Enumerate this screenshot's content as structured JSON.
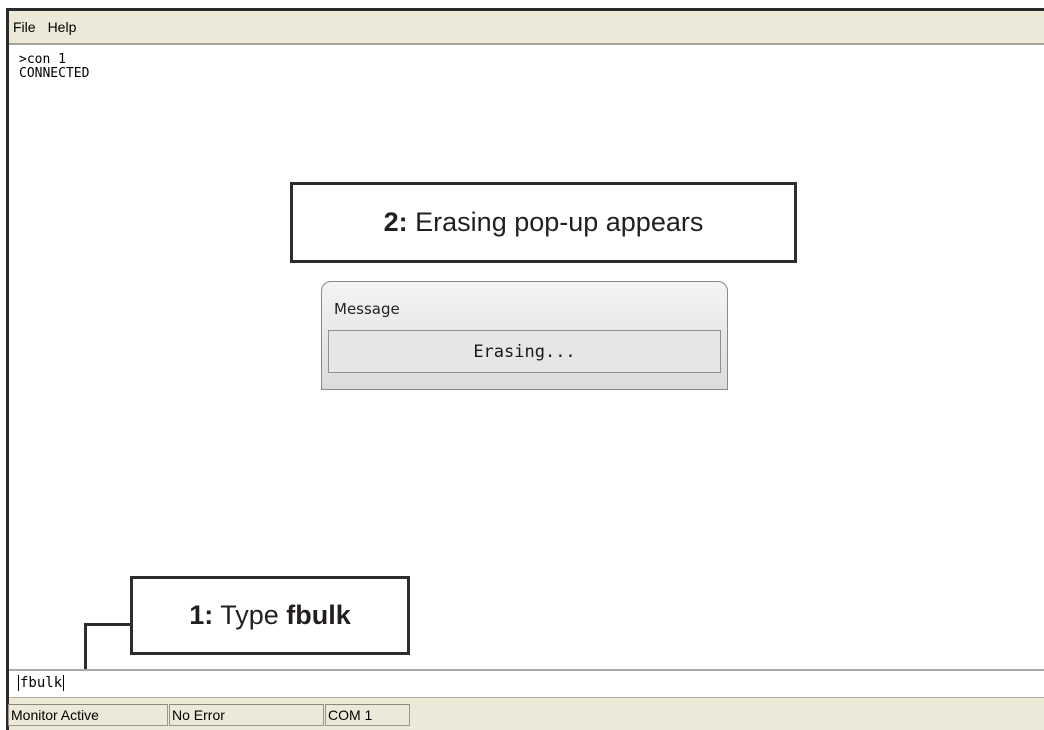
{
  "menu": {
    "items": [
      "File",
      "Help"
    ]
  },
  "terminal": {
    "lines": [
      ">con 1",
      "CONNECTED"
    ]
  },
  "callouts": {
    "step2": {
      "number": "2:",
      "text": " Erasing pop-up appears"
    },
    "step1": {
      "number": "1:",
      "text": " Type ",
      "command": "fbulk"
    }
  },
  "popup": {
    "title": "Message",
    "body": "Erasing..."
  },
  "input": {
    "value": "fbulk"
  },
  "status": {
    "monitor": "Monitor Active",
    "error": "No Error",
    "port": "COM 1"
  }
}
